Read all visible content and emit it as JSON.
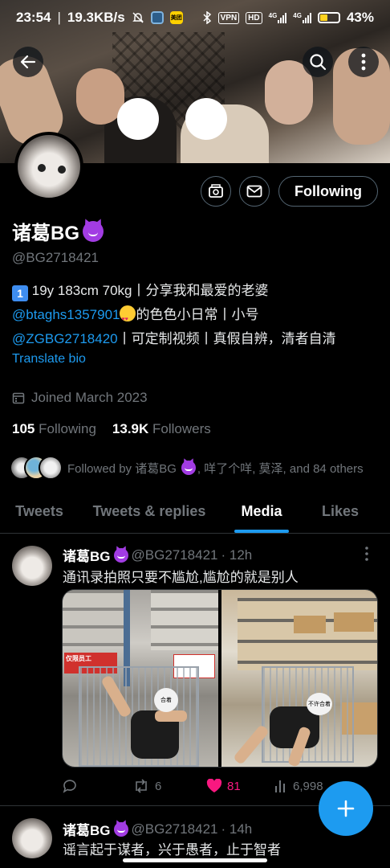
{
  "status_bar": {
    "time": "23:54",
    "speed": "19.3KB/s",
    "app_badge": "美团",
    "vpn": "VPN",
    "hd": "HD",
    "net1": "4G",
    "net2": "4G",
    "battery": "43%"
  },
  "profile": {
    "name": "诸葛BG",
    "handle": "@BG2718421",
    "follow_button": "Following",
    "bio_line1_text": "19y 183cm 70kg丨分享我和最爱的老婆",
    "bio_keycap": "1",
    "bio_mention1": "@btaghs1357901",
    "bio_line2_rest": "的色色小日常丨小号",
    "bio_mention2": "@ZGBG2718420",
    "bio_line3_rest": "丨可定制视频丨真假自辨，清者自清",
    "translate": "Translate bio",
    "joined": "Joined March 2023",
    "following_count": "105",
    "following_label": "Following",
    "followers_count": "13.9K",
    "followers_label": "Followers",
    "followed_by_prefix": "Followed by 诸葛BG",
    "followed_by_rest": ", 咩了个咩, 莫泽, and 84 others"
  },
  "tabs": [
    {
      "label": "Tweets"
    },
    {
      "label": "Tweets & replies"
    },
    {
      "label": "Media"
    },
    {
      "label": "Likes"
    }
  ],
  "tweets": [
    {
      "name": "诸葛BG",
      "handle": "@BG2718421",
      "time": "· 12h",
      "text": "通讯录拍照只要不尴尬,尴尬的就是别人",
      "replies": "",
      "retweets": "6",
      "likes": "81",
      "views": "6,998",
      "media_caption1": "合着",
      "media_caption2": "不许合着",
      "sign_text": "仅限员工"
    },
    {
      "name": "诸葛BG",
      "handle": "@BG2718421",
      "time": "· 14h",
      "text": "谣言起于谋者，兴于愚者，止于智者"
    }
  ],
  "colors": {
    "accent": "#1d9bf0",
    "like": "#f91880",
    "text_secondary": "#71767b"
  },
  "icons": [
    "back-arrow-icon",
    "search-icon",
    "more-vertical-icon",
    "bell-mute-icon",
    "bluetooth-icon",
    "calendar-icon",
    "reply-icon",
    "retweet-icon",
    "heart-icon",
    "views-icon",
    "plus-icon",
    "mail-icon",
    "camera-icon"
  ]
}
